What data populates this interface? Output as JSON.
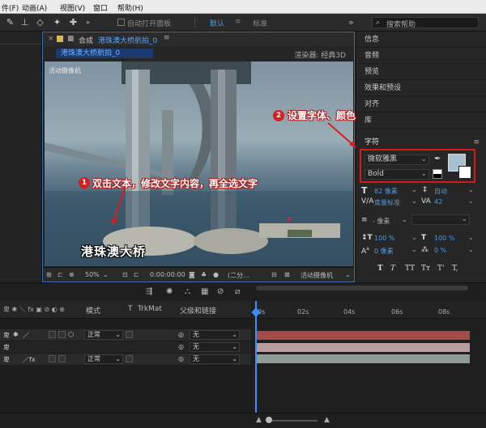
{
  "menubar": {
    "items": [
      "件(F)",
      "动画(A)",
      "视图(V)",
      "窗口",
      "帮助(H)"
    ]
  },
  "toolbar": {
    "auto_open_label": "自动打开面板",
    "workspace_default": "默认",
    "workspace_standard": "标准",
    "search_placeholder": "搜索帮助"
  },
  "comp_panel": {
    "tab_prefix": "合成",
    "tab_name": "港珠澳大桥航拍_0",
    "crumb": "港珠澳大桥航拍_0",
    "renderer": "渲染器: 经典3D",
    "camera_label": "活动摄像机",
    "overlay_title": "港珠澳大桥",
    "footer": {
      "zoom": "50%",
      "timecode": "0:00:00:00",
      "resolution": "(二分...",
      "camera": "活动摄像机"
    }
  },
  "right_panel": {
    "items": [
      "信息",
      "音频",
      "预览",
      "效果和预设",
      "对齐",
      "库"
    ],
    "character_title": "字符",
    "font_family": "微软雅黑",
    "font_style": "Bold",
    "font_size": "82 像素",
    "leading": "自动",
    "kerning": "度量标准",
    "tracking": "42",
    "stroke_width": "- 像素",
    "vscale": "100 %",
    "hscale": "100 %",
    "baseline": "0 像素",
    "tsume": "0 %",
    "text_style_buttons": [
      "T",
      "T",
      "TT",
      "Tᴛ",
      "T'",
      "T,"
    ]
  },
  "timeline": {
    "header": {
      "mode": "模式",
      "t": "T",
      "trkmat": "TrkMat",
      "parent": "父级和链接"
    },
    "rows": [
      {
        "mode": "正常",
        "parent": "无"
      },
      {
        "mode": "",
        "parent": "无"
      },
      {
        "mode": "正常",
        "parent": "无"
      }
    ],
    "ruler_labels": [
      "0s",
      "02s",
      "04s",
      "06s",
      "08s"
    ]
  },
  "annotations": [
    {
      "number": "1",
      "text": "双击文本，修改文字内容，再全选文字"
    },
    {
      "number": "2",
      "text": "设置字体、颜色"
    }
  ],
  "colors": {
    "accent": "#3a8cff",
    "annotation_red": "#d81e1e",
    "fill_color": "#a9c0d0",
    "bar_red": "#a44a4a",
    "bar_pink": "#b89ca0",
    "bar_gray": "#8f9a98"
  }
}
